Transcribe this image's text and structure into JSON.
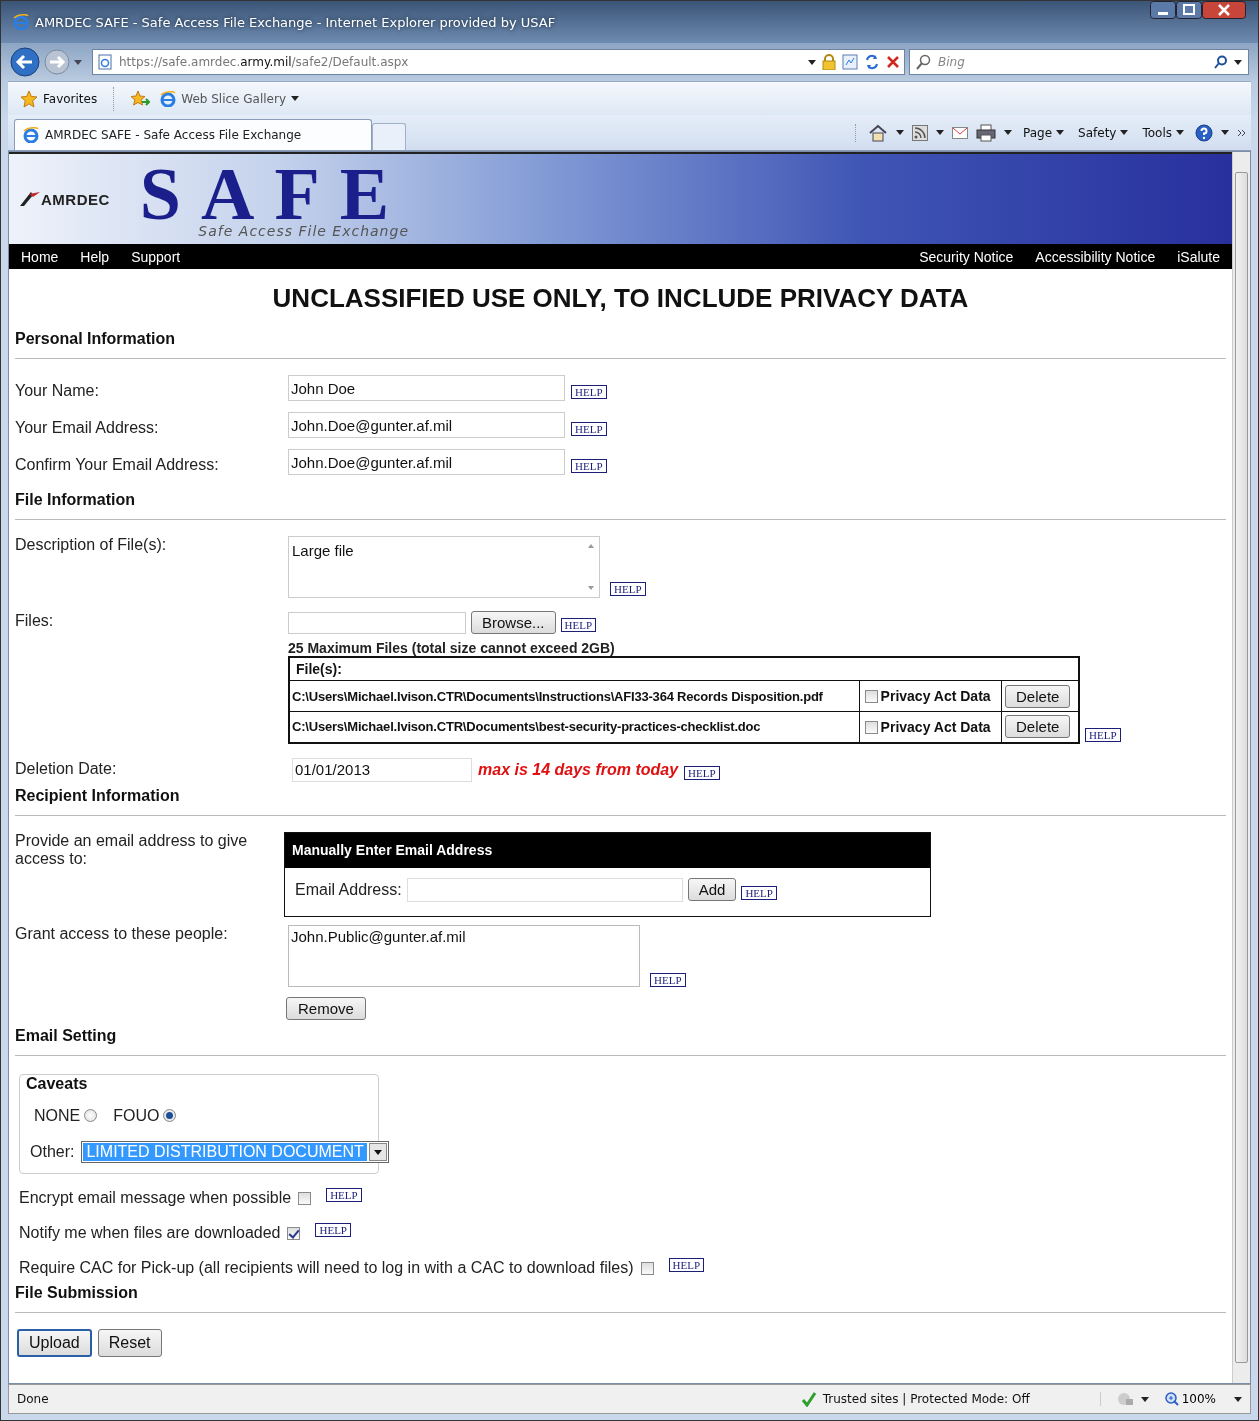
{
  "window": {
    "title": "AMRDEC SAFE - Safe Access File Exchange - Internet Explorer provided by USAF"
  },
  "address_bar": {
    "url": "https://safe.amrdec.**army.mil**/safe2/Default.aspx"
  },
  "search": {
    "placeholder": "Bing"
  },
  "favorites_bar": {
    "favorites": "Favorites",
    "items": [
      "Web Slice Gallery"
    ]
  },
  "tabs": [
    {
      "label": "AMRDEC SAFE - Safe Access File Exchange",
      "selected": true
    }
  ],
  "command_bar": [
    "Page",
    "Safety",
    "Tools"
  ],
  "site_header": {
    "logo": "AMRDEC",
    "title": "SAFE",
    "subtitle": "Safe Access File Exchange"
  },
  "nav": {
    "left": [
      "Home",
      "Help",
      "Support"
    ],
    "right": [
      "Security Notice",
      "Accessibility Notice",
      "iSalute"
    ]
  },
  "banner": "UNCLASSIFIED USE ONLY, TO INCLUDE PRIVACY DATA",
  "personal": {
    "heading": "Personal Information",
    "fields": [
      {
        "label": "Your Name:",
        "value": "John Doe",
        "help": "HELP"
      },
      {
        "label": "Your Email Address:",
        "value": "John.Doe@gunter.af.mil",
        "help": "HELP"
      },
      {
        "label": "Confirm Your Email Address:",
        "value": "John.Doe@gunter.af.mil",
        "help": "HELP"
      }
    ]
  },
  "file_info": {
    "heading": "File Information",
    "description": {
      "label": "Description of File(s):",
      "value": "Large file",
      "help": "HELP"
    },
    "files": {
      "label": "Files:",
      "browse": "Browse...",
      "help": "HELP",
      "limit_note": "25 Maximum Files (total size cannot exceed 2GB)",
      "table_header": "File(s):",
      "table_help": "HELP",
      "rows": [
        {
          "path": "C:\\Users\\Michael.Ivison.CTR\\Documents\\Instructions\\AFI33-364 Records Disposition.pdf",
          "privacy_label": "Privacy Act Data",
          "checked": false,
          "delete": "Delete"
        },
        {
          "path": "C:\\Users\\Michael.Ivison.CTR\\Documents\\best-security-practices-checklist.doc",
          "privacy_label": "Privacy Act Data",
          "checked": false,
          "delete": "Delete"
        }
      ]
    },
    "deletion": {
      "label": "Deletion Date:",
      "value": "01/01/2013",
      "note": "max is 14 days from today",
      "help": "HELP"
    }
  },
  "recipient": {
    "heading": "Recipient Information",
    "provide_label": "Provide an email address to give access to:",
    "manual": {
      "title": "Manually Enter Email Address",
      "label": "Email Address:",
      "add": "Add",
      "help": "HELP"
    },
    "grant_label": "Grant access to these people:",
    "grant_list": [
      "John.Public@gunter.af.mil"
    ],
    "grant_help": "HELP",
    "remove": "Remove"
  },
  "email_setting": {
    "heading": "Email Setting",
    "caveats": {
      "legend": "Caveats",
      "options": [
        {
          "label": "NONE",
          "selected": false
        },
        {
          "label": "FOUO",
          "selected": true
        }
      ],
      "other_label": "Other:",
      "other_value": "LIMITED DISTRIBUTION DOCUMENT"
    },
    "options": [
      {
        "label": "Encrypt email message when possible",
        "checked": false,
        "help": "HELP"
      },
      {
        "label": "Notify me when files are downloaded",
        "checked": true,
        "help": "HELP"
      },
      {
        "label": "Require CAC for Pick-up (all recipients will need to log in with a CAC to download files)",
        "checked": false,
        "help": "HELP"
      }
    ]
  },
  "submission": {
    "heading": "File Submission",
    "buttons": [
      "Upload",
      "Reset"
    ]
  },
  "status_bar": {
    "status": "Done",
    "zone": "Trusted sites | Protected Mode: Off",
    "zoom": "100%"
  }
}
